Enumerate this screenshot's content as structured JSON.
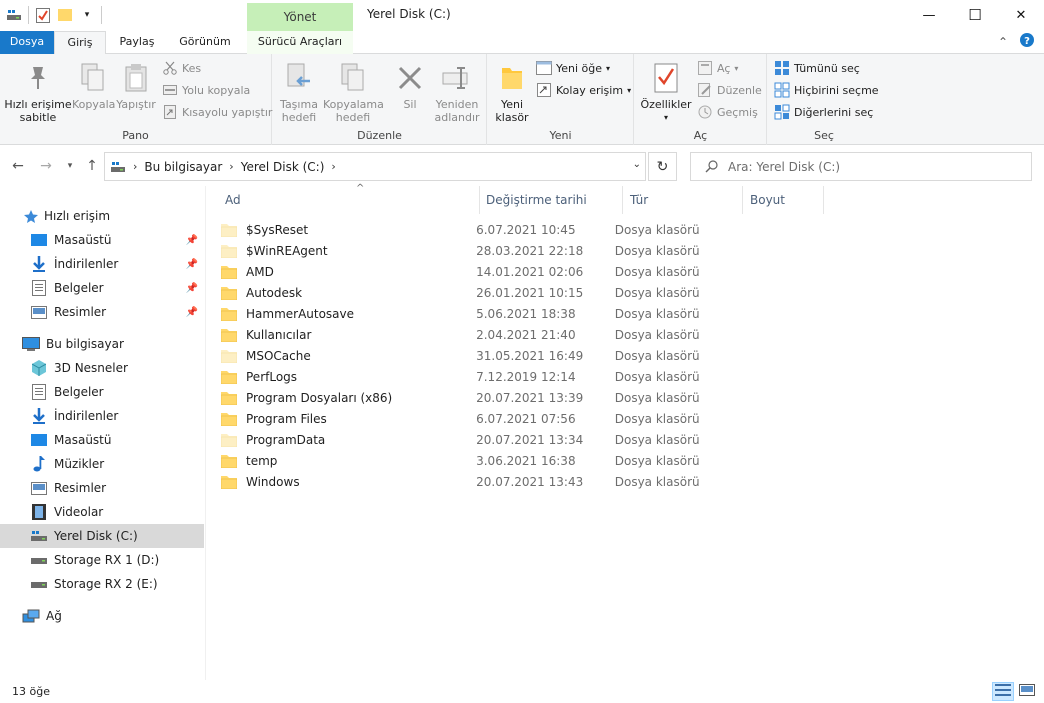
{
  "window": {
    "title": "Yerel Disk (C:)",
    "context_tab_header": "Yönet",
    "minimize": "—",
    "maximize": "☐",
    "close": "✕"
  },
  "tabs": [
    {
      "label": "Dosya"
    },
    {
      "label": "Giriş"
    },
    {
      "label": "Paylaş"
    },
    {
      "label": "Görünüm"
    },
    {
      "label": "Sürücü Araçları"
    }
  ],
  "ribbon": {
    "pano": {
      "label": "Pano",
      "pin_quick_access": "Hızlı erişime\nsabitle",
      "copy": "Kopyala",
      "paste": "Yapıştır",
      "cut": "Kes",
      "copy_path": "Yolu kopyala",
      "paste_shortcut": "Kısayolu yapıştır"
    },
    "duzenle": {
      "label": "Düzenle",
      "move_to": "Taşıma\nhedefi",
      "copy_to": "Kopyalama\nhedefi",
      "delete": "Sil",
      "rename": "Yeniden\nadlandır"
    },
    "yeni": {
      "label": "Yeni",
      "new_folder": "Yeni\nklasör",
      "new_item": "Yeni öğe",
      "easy_access": "Kolay erişim"
    },
    "ac": {
      "label": "Aç",
      "properties": "Özellikler",
      "open": "Aç",
      "edit": "Düzenle",
      "history": "Geçmiş"
    },
    "sec": {
      "label": "Seç",
      "select_all": "Tümünü seç",
      "select_none": "Hiçbirini seçme",
      "invert": "Diğerlerini seç"
    }
  },
  "address": {
    "crumbs": [
      "Bu bilgisayar",
      "Yerel Disk (C:)"
    ],
    "search_placeholder": "Ara: Yerel Disk (C:)"
  },
  "nav": {
    "quick_access": "Hızlı erişim",
    "quick_items": [
      "Masaüstü",
      "İndirilenler",
      "Belgeler",
      "Resimler"
    ],
    "this_pc": "Bu bilgisayar",
    "pc_items": [
      "3D Nesneler",
      "Belgeler",
      "İndirilenler",
      "Masaüstü",
      "Müzikler",
      "Resimler",
      "Videolar",
      "Yerel Disk (C:)",
      "Storage RX 1 (D:)",
      "Storage RX 2 (E:)"
    ],
    "network": "Ağ"
  },
  "columns": {
    "name": "Ad",
    "modified": "Değiştirme tarihi",
    "type": "Tür",
    "size": "Boyut"
  },
  "files": [
    {
      "name": "$SysReset",
      "date": "6.07.2021 10:45",
      "type": "Dosya klasörü",
      "hidden": true
    },
    {
      "name": "$WinREAgent",
      "date": "28.03.2021 22:18",
      "type": "Dosya klasörü",
      "hidden": true
    },
    {
      "name": "AMD",
      "date": "14.01.2021 02:06",
      "type": "Dosya klasörü",
      "hidden": false
    },
    {
      "name": "Autodesk",
      "date": "26.01.2021 10:15",
      "type": "Dosya klasörü",
      "hidden": false
    },
    {
      "name": "HammerAutosave",
      "date": "5.06.2021 18:38",
      "type": "Dosya klasörü",
      "hidden": false
    },
    {
      "name": "Kullanıcılar",
      "date": "2.04.2021 21:40",
      "type": "Dosya klasörü",
      "hidden": false
    },
    {
      "name": "MSOCache",
      "date": "31.05.2021 16:49",
      "type": "Dosya klasörü",
      "hidden": true
    },
    {
      "name": "PerfLogs",
      "date": "7.12.2019 12:14",
      "type": "Dosya klasörü",
      "hidden": false
    },
    {
      "name": "Program Dosyaları (x86)",
      "date": "20.07.2021 13:39",
      "type": "Dosya klasörü",
      "hidden": false
    },
    {
      "name": "Program Files",
      "date": "6.07.2021 07:56",
      "type": "Dosya klasörü",
      "hidden": false
    },
    {
      "name": "ProgramData",
      "date": "20.07.2021 13:34",
      "type": "Dosya klasörü",
      "hidden": true
    },
    {
      "name": "temp",
      "date": "3.06.2021 16:38",
      "type": "Dosya klasörü",
      "hidden": false
    },
    {
      "name": "Windows",
      "date": "20.07.2021 13:43",
      "type": "Dosya klasörü",
      "hidden": false
    }
  ],
  "status": {
    "count": "13 öğe"
  },
  "colors": {
    "accent": "#1979ca",
    "context_tab": "#c6efb8",
    "folder": "#ffd86b",
    "folder_hidden": "#fdefc4",
    "selected_nav": "#d9d9d9"
  }
}
